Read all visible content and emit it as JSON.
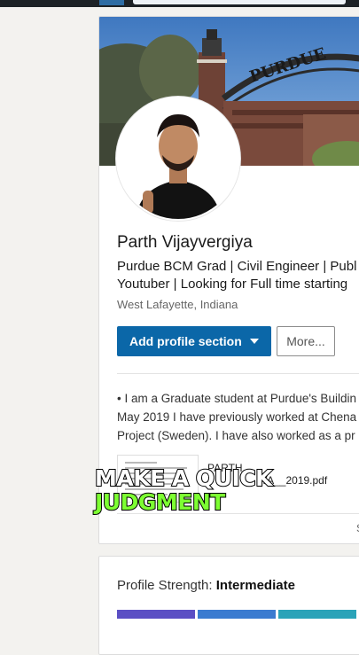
{
  "banner": {
    "sign_text": "PURDUE"
  },
  "profile": {
    "name": "Parth Vijayvergiya",
    "headline_line1": "Purdue BCM Grad | Civil Engineer | Publ",
    "headline_line2": "Youtuber | Looking for Full time starting",
    "location": "West Lafayette, Indiana"
  },
  "actions": {
    "add_section_label": "Add profile section",
    "more_label": "More..."
  },
  "summary": {
    "line1": "• I am a Graduate student at Purdue's Buildin",
    "line2": "May 2019 I have previously worked at Chena",
    "line3": "Project (Sweden). I have also worked as a pr"
  },
  "document": {
    "name_line1": "PARTH",
    "name_line2": "YA__2019.pdf"
  },
  "caption": {
    "line1": "MAKE A QUICK",
    "line2": "JUDGMENT"
  },
  "strength": {
    "label": "Profile Strength:",
    "level": "Intermediate",
    "segments_filled": 3,
    "colors": [
      "#5b4fc4",
      "#3a7bd0",
      "#2aa3b8"
    ]
  }
}
